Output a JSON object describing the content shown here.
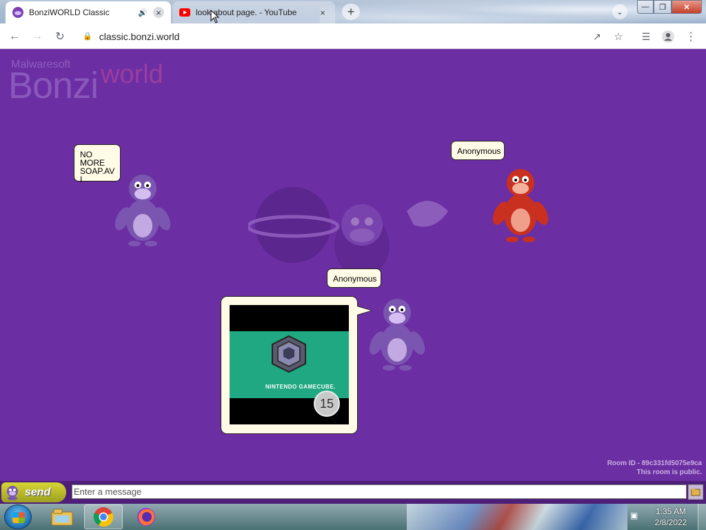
{
  "browser": {
    "tabs": [
      {
        "title": "BonziWORLD Classic",
        "icon": "bonzi-favicon",
        "active": true,
        "audio": true
      },
      {
        "title": "look about page. - YouTube",
        "icon": "youtube-favicon",
        "active": false
      }
    ],
    "address": "classic.bonzi.world"
  },
  "page": {
    "logo": {
      "top": "Malwaresoft",
      "main": "Bonzi",
      "suffix": "world"
    },
    "users": [
      {
        "name": "NO MORE SOAP.AVI",
        "color": "purple"
      },
      {
        "name": "Anonymous",
        "color": "red"
      },
      {
        "name": "Anonymous",
        "color": "purple"
      }
    ],
    "video": {
      "logo_text": "NINTENDO GAMECUBE.",
      "counter": "15"
    },
    "room": {
      "id_line": "Room ID - 89c331fd5075e9ca",
      "status": "This room is public."
    }
  },
  "chat": {
    "send_label": "send",
    "placeholder": "Enter a message"
  },
  "taskbar": {
    "apps": [
      "Windows Explorer",
      "Google Chrome",
      "Firefox"
    ],
    "time": "1:35 AM",
    "date": "2/8/2022"
  },
  "colors": {
    "page_bg": "#6c2ea3",
    "bubble_bg": "#fffbe6",
    "send_btn": "#c4c42c",
    "video_green": "#1fa882"
  }
}
